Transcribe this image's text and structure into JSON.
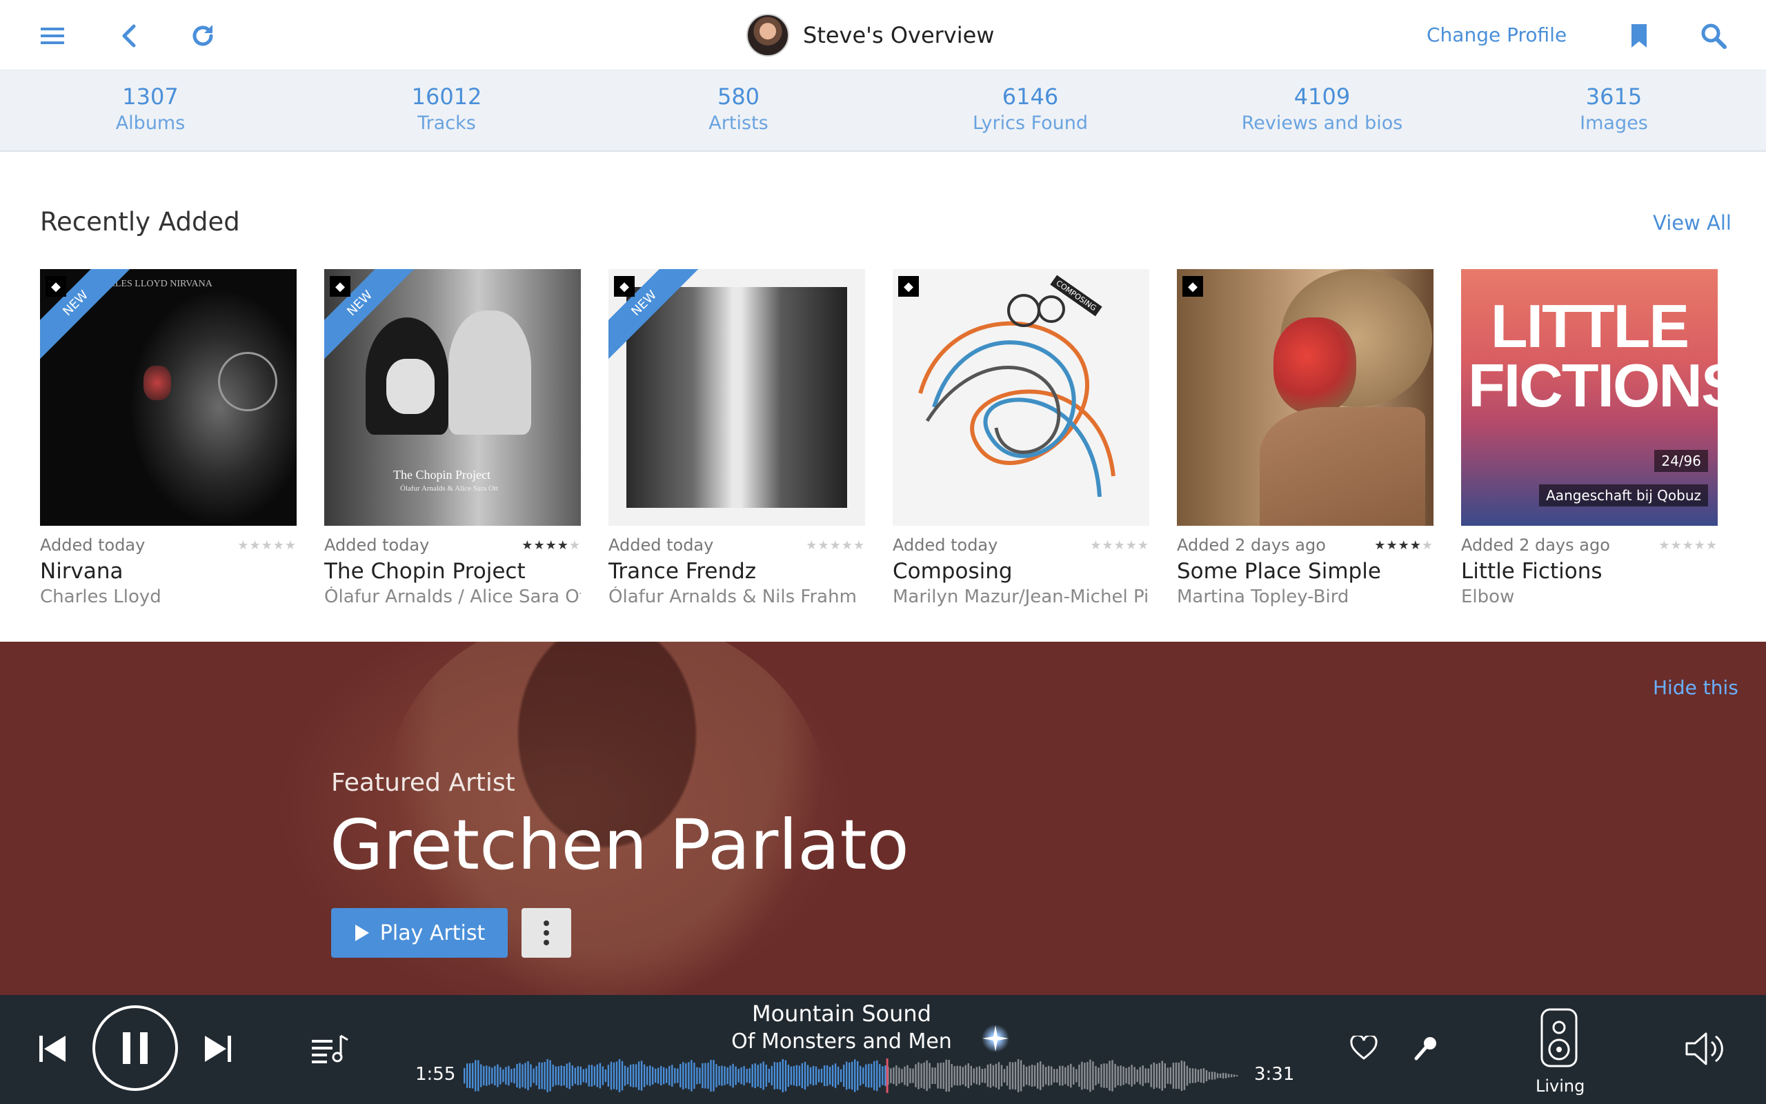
{
  "header": {
    "title": "Steve's Overview",
    "change_profile": "Change Profile"
  },
  "stats": [
    {
      "value": "1307",
      "label": "Albums"
    },
    {
      "value": "16012",
      "label": "Tracks"
    },
    {
      "value": "580",
      "label": "Artists"
    },
    {
      "value": "6146",
      "label": "Lyrics Found"
    },
    {
      "value": "4109",
      "label": "Reviews and bios"
    },
    {
      "value": "3615",
      "label": "Images"
    }
  ],
  "recent": {
    "title": "Recently Added",
    "view_all": "View All",
    "new_label": "NEW",
    "albums": [
      {
        "added": "Added today",
        "title": "Nirvana",
        "artist": "Charles Lloyd",
        "rating": 0,
        "is_new": true,
        "cover_text": "CHARLES LLOYD NIRVANA"
      },
      {
        "added": "Added today",
        "title": "The Chopin Project",
        "artist": "Ólafur Arnalds / Alice Sara Ott",
        "rating": 3.5,
        "is_new": true,
        "cover_text": "The Chopin Project",
        "cover_subtext": "Ólafur Arnalds & Alice Sara Ott"
      },
      {
        "added": "Added today",
        "title": "Trance Frendz",
        "artist": "Ólafur Arnalds & Nils Frahm",
        "rating": 0,
        "is_new": true
      },
      {
        "added": "Added today",
        "title": "Composing",
        "artist": "Marilyn Mazur/Jean-Michel Pilc",
        "rating": 0,
        "is_new": false,
        "cover_text": "COMPOSING"
      },
      {
        "added": "Added 2 days ago",
        "title": "Some Place Simple",
        "artist": "Martina Topley-Bird",
        "rating": 4,
        "is_new": false
      },
      {
        "added": "Added 2 days ago",
        "title": "Little Fictions",
        "artist": "Elbow",
        "rating": 0,
        "is_new": false,
        "cover_text": "LITTLE FICTIONS",
        "cover_quality": "24/96",
        "cover_source": "Aangeschaft bij Qobuz"
      }
    ]
  },
  "featured": {
    "hide": "Hide this",
    "label": "Featured Artist",
    "name": "Gretchen Parlato",
    "play": "Play Artist"
  },
  "player": {
    "track": "Mountain Sound",
    "artist": "Of Monsters and Men",
    "elapsed": "1:55",
    "duration": "3:31",
    "progress": 0.545,
    "zone": "Living"
  },
  "colors": {
    "accent": "#4a8fd9",
    "player_bg": "#222a31",
    "featured_bg": "#6b2e2b"
  }
}
